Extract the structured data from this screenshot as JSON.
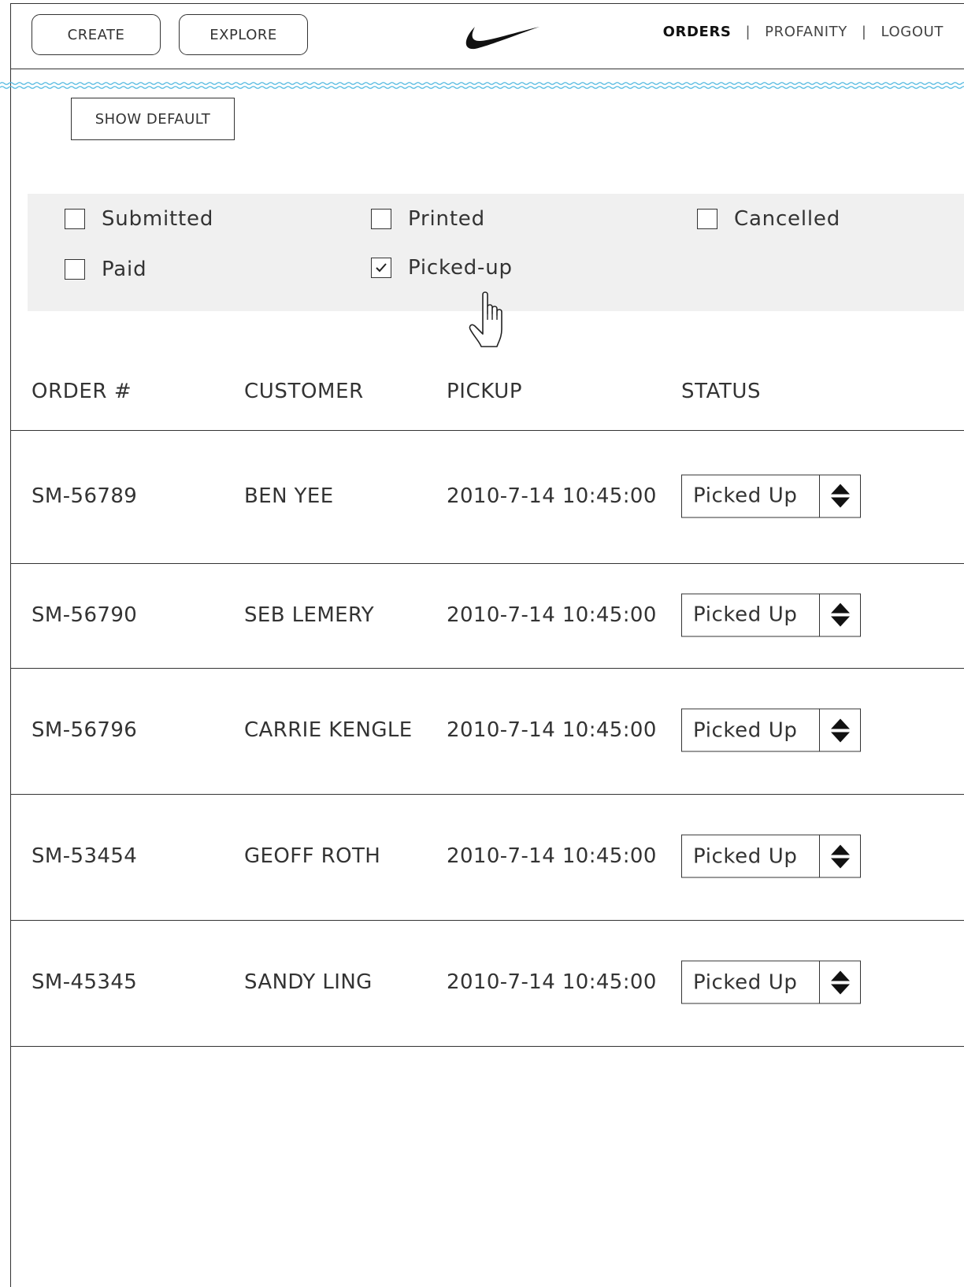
{
  "header": {
    "create_label": "CREATE",
    "explore_label": "EXPLORE",
    "logo_icon": "nike-swoosh-icon",
    "nav": {
      "orders": "ORDERS",
      "sep1": "|",
      "profanity": "PROFANITY",
      "sep2": "|",
      "logout": "LOGOUT"
    }
  },
  "show_default_label": "SHOW DEFAULT",
  "filters": [
    {
      "label": "Submitted",
      "checked": false
    },
    {
      "label": "Printed",
      "checked": false
    },
    {
      "label": "Cancelled",
      "checked": false
    },
    {
      "label": "Paid",
      "checked": false
    },
    {
      "label": "Picked-up",
      "checked": true
    }
  ],
  "table": {
    "headers": {
      "order": "ORDER #",
      "customer": "CUSTOMER",
      "pickup": "PICKUP",
      "status": "STATUS"
    },
    "rows": [
      {
        "order": "SM-56789",
        "customer": "BEN YEE",
        "pickup": "2010-7-14 10:45:00",
        "status": "Picked Up"
      },
      {
        "order": "SM-56790",
        "customer": "SEB LEMERY",
        "pickup": "2010-7-14 10:45:00",
        "status": "Picked Up"
      },
      {
        "order": "SM-56796",
        "customer": "CARRIE KENGLE",
        "pickup": "2010-7-14 10:45:00",
        "status": "Picked Up"
      },
      {
        "order": "SM-53454",
        "customer": "GEOFF ROTH",
        "pickup": "2010-7-14 10:45:00",
        "status": "Picked Up"
      },
      {
        "order": "SM-45345",
        "customer": "SANDY LING",
        "pickup": "2010-7-14 10:45:00",
        "status": "Picked Up"
      }
    ]
  },
  "colors": {
    "wave": "#4fb8e0",
    "panel": "#f0f0f0",
    "line": "#333333"
  }
}
